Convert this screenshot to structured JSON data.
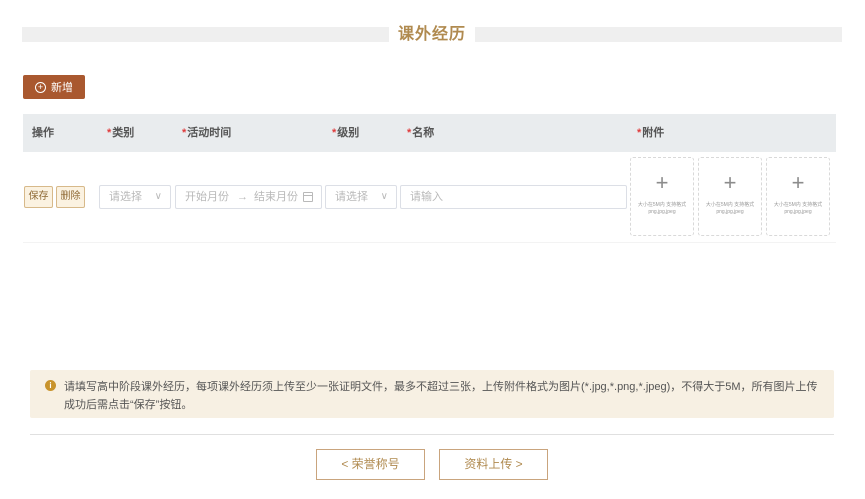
{
  "section": {
    "title": "课外经历"
  },
  "toolbar": {
    "add_label": "新增",
    "add_icon": "plus-circle-icon"
  },
  "table": {
    "headers": {
      "action": "操作",
      "category": "类别",
      "time": "活动时间",
      "level": "级别",
      "name": "名称",
      "attachment": "附件"
    },
    "row": {
      "save_label": "保存",
      "delete_label": "删除",
      "category_placeholder": "请选择",
      "start_placeholder": "开始月份",
      "range_separator": "→",
      "end_placeholder": "结束月份",
      "level_placeholder": "请选择",
      "name_placeholder": "请输入",
      "uploads": [
        {
          "plus": "+",
          "hint": "大小在5M内 支持格式 png,jpg,jpeg"
        },
        {
          "plus": "+",
          "hint": "大小在5M内 支持格式 png,jpg,jpeg"
        },
        {
          "plus": "+",
          "hint": "大小在5M内 支持格式 png,jpg,jpeg"
        }
      ]
    }
  },
  "notice": {
    "icon": "info-icon",
    "text": "请填写高中阶段课外经历，每项课外经历须上传至少一张证明文件，最多不超过三张，上传附件格式为图片(*.jpg,*.png,*.jpeg)，不得大于5M，所有图片上传成功后需点击“保存”按钮。"
  },
  "footer": {
    "prev_label": "< 荣誉称号",
    "next_label": "资料上传 >"
  },
  "colors": {
    "accent": "#a9582f",
    "gold": "#b08a4f",
    "required": "#e03c3c"
  }
}
